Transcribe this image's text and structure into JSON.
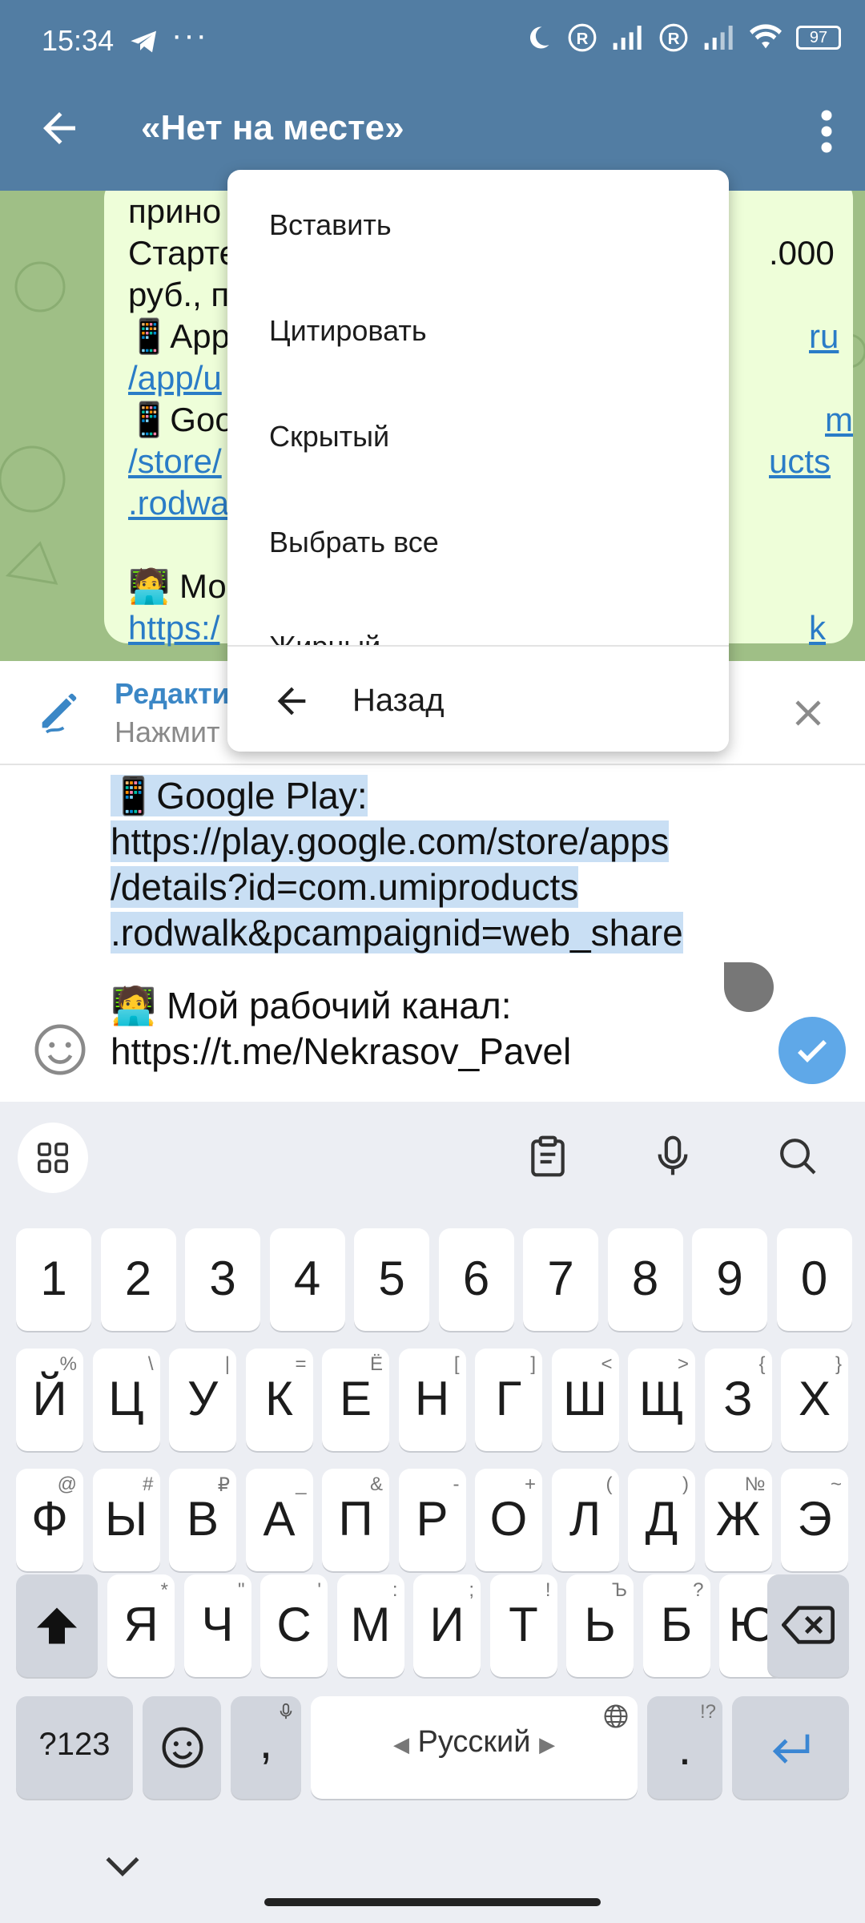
{
  "status_bar": {
    "time": "15:34",
    "dots": "···",
    "battery": "97"
  },
  "app_bar": {
    "title": "«Нет на месте»"
  },
  "chat": {
    "lines": [
      "прино",
      "Старте",
      "руб., п",
      "📱App",
      "/app/u",
      "📱Goo",
      "/store/",
      ".rodwa",
      "",
      "🧑‍💻 Мо",
      "https:/"
    ],
    "right_fragments": [
      ".000",
      "ru",
      "m",
      "ucts",
      "k"
    ]
  },
  "edit_bar": {
    "title": "Редакти",
    "subtitle": "Нажмит"
  },
  "input": {
    "selected_lines": [
      "📱Google Play:",
      "https://play.google.com/store/apps",
      "/details?id=com.umiproducts",
      ".rodwalk&pcampaignid=web_share"
    ],
    "line_channel": "🧑‍💻 Мой рабочий канал:",
    "line_link": "https://t.me/Nekrasov_Pavel"
  },
  "context_menu": {
    "items": [
      "Вставить",
      "Цитировать",
      "Скрытый",
      "Выбрать все",
      "Жирный"
    ],
    "back_label": "Назад"
  },
  "keyboard": {
    "row_numbers": [
      "1",
      "2",
      "3",
      "4",
      "5",
      "6",
      "7",
      "8",
      "9",
      "0"
    ],
    "row1": [
      [
        "Й",
        "%"
      ],
      [
        "Ц",
        "\\"
      ],
      [
        "У",
        "|"
      ],
      [
        "К",
        "="
      ],
      [
        "Е",
        "Ё"
      ],
      [
        "Н",
        "["
      ],
      [
        "Г",
        "]"
      ],
      [
        "Ш",
        "<"
      ],
      [
        "Щ",
        ">"
      ],
      [
        "З",
        "{"
      ],
      [
        "Х",
        "}"
      ]
    ],
    "row2": [
      [
        "Ф",
        "@"
      ],
      [
        "Ы",
        "#"
      ],
      [
        "В",
        "₽"
      ],
      [
        "А",
        "_"
      ],
      [
        "П",
        "&"
      ],
      [
        "Р",
        "-"
      ],
      [
        "О",
        "+"
      ],
      [
        "Л",
        "("
      ],
      [
        "Д",
        ")"
      ],
      [
        "Ж",
        "№"
      ],
      [
        "Э",
        "~"
      ]
    ],
    "row3": [
      [
        "Я",
        "*"
      ],
      [
        "Ч",
        "\""
      ],
      [
        "С",
        "'"
      ],
      [
        "М",
        ":"
      ],
      [
        "И",
        ";"
      ],
      [
        "Т",
        "!"
      ],
      [
        "Ь",
        "Ъ"
      ],
      [
        "Б",
        "?"
      ],
      [
        "Ю",
        "°"
      ]
    ],
    "symbols_key": "?123",
    "comma": ",",
    "space_label": "Русский",
    "period": ".",
    "period_sup": "!?"
  }
}
